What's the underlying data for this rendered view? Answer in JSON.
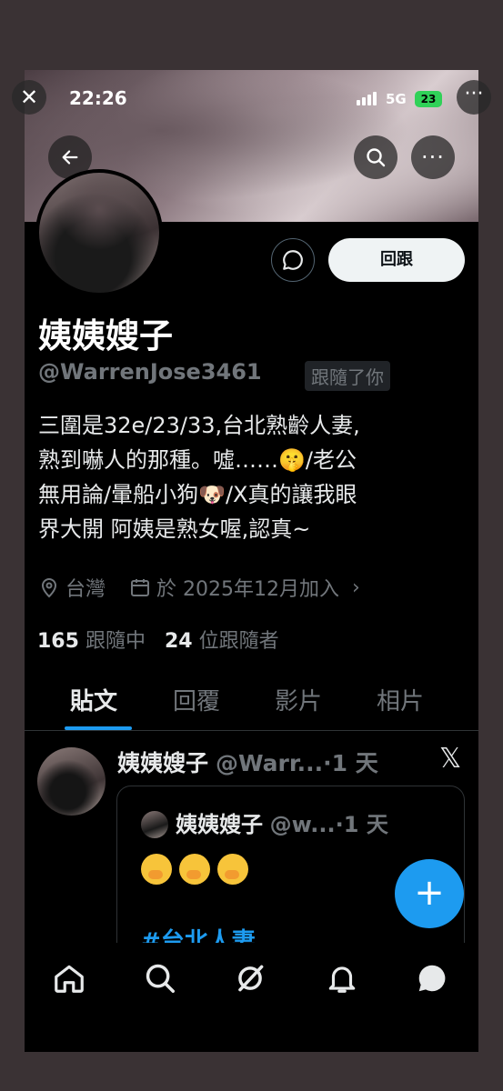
{
  "status": {
    "time": "22:26",
    "network": "5G",
    "battery": "23"
  },
  "profile": {
    "name": "姨姨嫂子",
    "handle": "@WarrenJose3461",
    "follows_you": "跟隨了你",
    "follow_back_label": "回跟",
    "bio_lines": [
      "三圍是32e/23/33,台北熟齡人妻,",
      "熟到嚇人的那種。噓……🤫/老公",
      "無用論/暈船小狗🐶/X真的讓我眼",
      "界大開 阿姨是熟女喔,認真~"
    ],
    "location": "台灣",
    "joined": "於 2025年12月加入",
    "following_count": "165",
    "following_label": "跟隨中",
    "followers_count": "24",
    "followers_label": "位跟隨者"
  },
  "tabs": [
    "貼文",
    "回覆",
    "影片",
    "相片"
  ],
  "post": {
    "author": "姨姨嫂子",
    "handle": "@Warr...",
    "time": "·1 天",
    "quote": {
      "author": "姨姨嫂子",
      "handle": "@w...",
      "time": "·1 天",
      "hashtag": "#台北人妻"
    }
  },
  "colors": {
    "accent": "#1d9bf0",
    "background": "#000000",
    "muted": "#71767b"
  },
  "icons": [
    "close-icon",
    "back-arrow-icon",
    "search-icon",
    "more-icon",
    "message-icon",
    "location-icon",
    "calendar-icon",
    "x-logo-icon",
    "plus-icon",
    "home-icon",
    "grok-icon",
    "bell-icon",
    "chat-icon"
  ]
}
